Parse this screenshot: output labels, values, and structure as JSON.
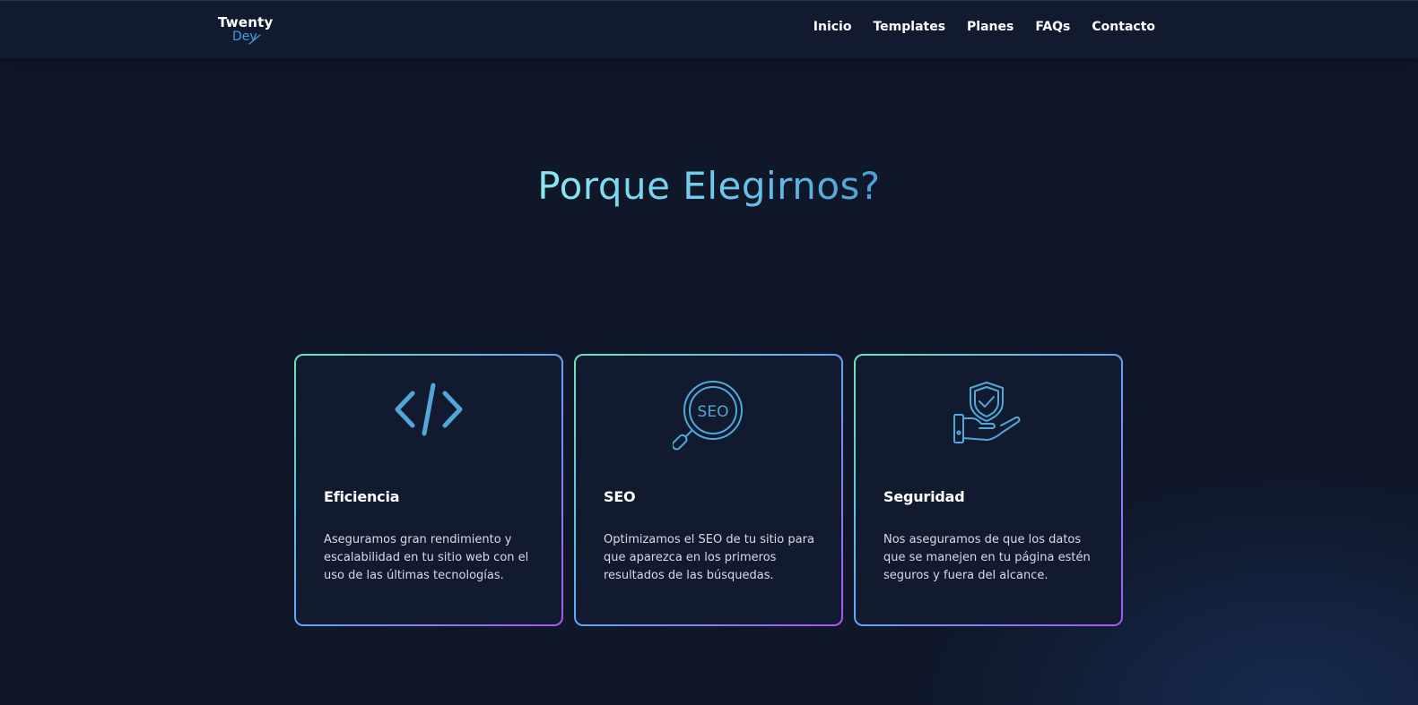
{
  "colors": {
    "background": "#0f1729",
    "navbar": "#111a2e",
    "accent_blue": "#4fa8d8",
    "gradient_start": "#6ee7b7",
    "gradient_mid": "#60a5fa",
    "gradient_end": "#a855f7"
  },
  "logo": {
    "top": "Twenty",
    "bottom": "Dev"
  },
  "nav": {
    "items": [
      {
        "label": "Inicio"
      },
      {
        "label": "Templates"
      },
      {
        "label": "Planes"
      },
      {
        "label": "FAQs"
      },
      {
        "label": "Contacto"
      }
    ]
  },
  "hero": {
    "title": "Porque Elegirnos?"
  },
  "features": [
    {
      "icon": "code-icon",
      "title": "Eficiencia",
      "text": "Aseguramos gran rendimiento y escalabilidad en tu sitio web con el uso de las últimas tecnologías."
    },
    {
      "icon": "seo-magnifier-icon",
      "icon_text": "SEO",
      "title": "SEO",
      "text": "Optimizamos el SEO de tu sitio para que aparezca en los primeros resultados de las búsquedas."
    },
    {
      "icon": "shield-hand-icon",
      "title": "Seguridad",
      "text": "Nos aseguramos de que los datos que se manejen en tu página estén seguros y fuera del alcance."
    }
  ]
}
